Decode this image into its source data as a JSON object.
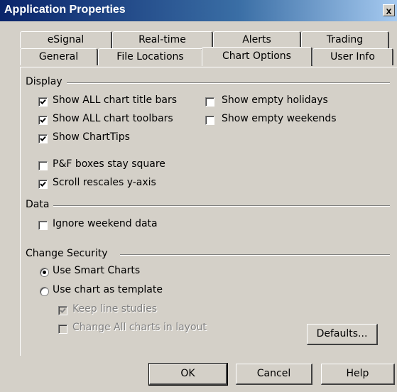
{
  "window": {
    "title": "Application Properties",
    "close_label": "x"
  },
  "tabs": {
    "row_back": [
      "eSignal",
      "Real-time",
      "Alerts",
      "Trading"
    ],
    "row_front": [
      "General",
      "File Locations",
      "Chart Options",
      "User Info"
    ],
    "active": "Chart Options"
  },
  "display": {
    "title": "Display",
    "options": [
      {
        "label": "Show ALL chart title bars",
        "checked": true
      },
      {
        "label": "Show ALL chart toolbars",
        "checked": true
      },
      {
        "label": "Show ChartTips",
        "checked": true
      },
      {
        "label": "P&F boxes stay square",
        "checked": false
      },
      {
        "label": "Scroll rescales y-axis",
        "checked": true
      },
      {
        "label": "Show empty holidays",
        "checked": false
      },
      {
        "label": "Show empty weekends",
        "checked": false
      }
    ]
  },
  "data_group": {
    "title": "Data",
    "options": [
      {
        "label": "Ignore weekend data",
        "checked": false
      }
    ]
  },
  "change_security": {
    "title": "Change Security",
    "radios": [
      {
        "label": "Use Smart Charts",
        "selected": true
      },
      {
        "label": "Use chart as template",
        "selected": false
      }
    ],
    "sub_options": [
      {
        "label": "Keep line studies",
        "checked": true,
        "disabled": true
      },
      {
        "label": "Change All charts in layout",
        "checked": false,
        "disabled": true
      }
    ]
  },
  "buttons": {
    "defaults": "Defaults...",
    "ok": "OK",
    "cancel": "Cancel",
    "help": "Help"
  }
}
